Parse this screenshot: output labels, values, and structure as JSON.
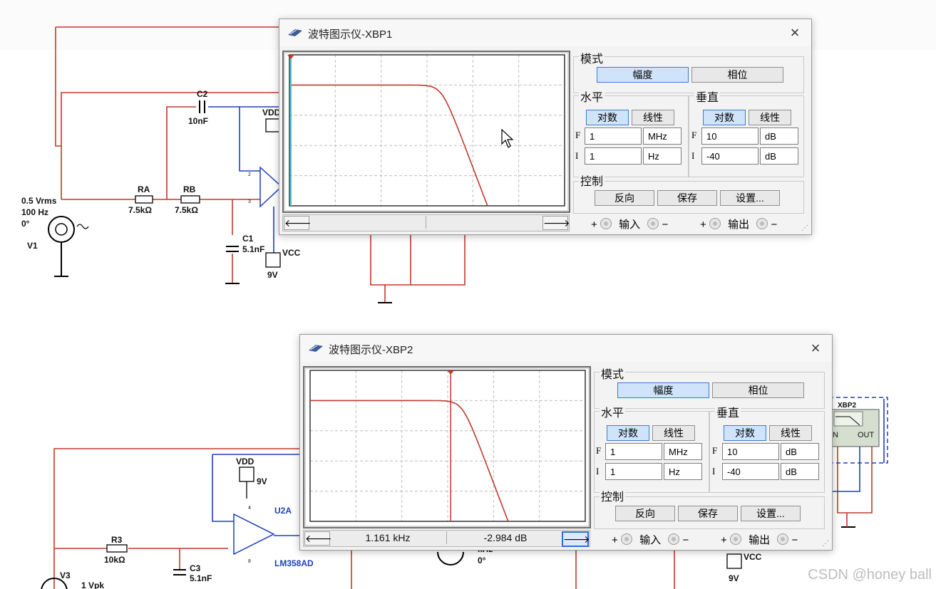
{
  "schematic": {
    "labels": {
      "c2_name": "C2",
      "c2_value": "10nF",
      "vdd1": "VDD",
      "v1_line1": "0.5 Vrms",
      "v1_line2": "100 Hz",
      "v1_line3": "0°",
      "v1_name": "V1",
      "ra_name": "RA",
      "ra_value": "7.5kΩ",
      "rb_name": "RB",
      "rb_value": "7.5kΩ",
      "c1_name": "C1",
      "c1_value": "5.1nF",
      "vcc1": "VCC",
      "vcc1_value": "9V",
      "vdd2": "VDD",
      "vdd2_value": "9V",
      "u2a": "U2A",
      "lm358": "LM358AD",
      "r3_name": "R3",
      "r3_value": "10kΩ",
      "c3_name": "C3",
      "c3_value": "5.1nF",
      "v3_name": "V3",
      "v3_value": "1 Vpk",
      "khz": "kHz",
      "zero_deg": "0°",
      "vcc2": "VCC",
      "vcc2_value": "9V",
      "xbp2_box_title": "XBP2",
      "xbp2_in": "IN",
      "xbp2_out": "OUT",
      "pin2": "2",
      "pin3": "3",
      "pin8": "8",
      "pin4": "4",
      "pin4b": "4",
      "pin8b": "8"
    }
  },
  "window1": {
    "title": "波特图示仪-XBP1",
    "close": "×",
    "mode_label": "模式",
    "mode_buttons": [
      "幅度",
      "相位"
    ],
    "horizontal_label": "水平",
    "vertical_label": "垂直",
    "scale_buttons": [
      "对数",
      "线性"
    ],
    "h_f_value": "1",
    "h_f_unit": "MHz",
    "h_i_value": "1",
    "h_i_unit": "Hz",
    "v_f_value": "10",
    "v_f_unit": "dB",
    "v_i_value": "-40",
    "v_i_unit": "dB",
    "f_letter": "F",
    "i_letter": "I",
    "control_label": "控制",
    "control_buttons": [
      "反向",
      "保存",
      "设置..."
    ],
    "plus": "+",
    "minus": "−",
    "input_label": "输入",
    "output_label": "输出",
    "readout_freq": "",
    "readout_db": "",
    "left_arrow": "🡐",
    "right_arrow": "🡒"
  },
  "window2": {
    "title": "波特图示仪-XBP2",
    "close": "×",
    "mode_label": "模式",
    "mode_buttons": [
      "幅度",
      "相位"
    ],
    "horizontal_label": "水平",
    "vertical_label": "垂直",
    "scale_buttons": [
      "对数",
      "线性"
    ],
    "h_f_value": "1",
    "h_f_unit": "MHz",
    "h_i_value": "1",
    "h_i_unit": "Hz",
    "v_f_value": "10",
    "v_f_unit": "dB",
    "v_i_value": "-40",
    "v_i_unit": "dB",
    "f_letter": "F",
    "i_letter": "I",
    "control_label": "控制",
    "control_buttons": [
      "反向",
      "保存",
      "设置..."
    ],
    "plus": "+",
    "minus": "−",
    "input_label": "输入",
    "output_label": "输出",
    "readout_freq": "1.161 kHz",
    "readout_db": "-2.984 dB",
    "left_arrow": "🡐",
    "right_arrow": "🡒"
  },
  "plot_settings": {
    "horizontal_scale": "log",
    "h_min_hz": 1,
    "h_max_hz": 1000000,
    "vertical_min_db": -40,
    "vertical_max_db": 10,
    "curve_color": "#c0392b",
    "cursor_color": "#c0392b",
    "cursor1_color": "#40c8d8",
    "cursor_freq_hz": 1161,
    "cursor_db": -2.984
  },
  "watermark": "CSDN @honey ball"
}
